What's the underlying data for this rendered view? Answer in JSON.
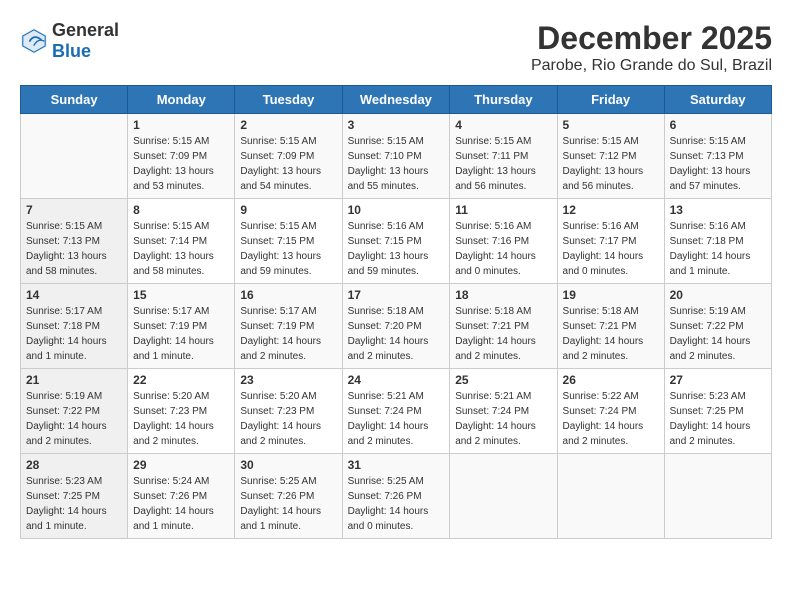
{
  "logo": {
    "general": "General",
    "blue": "Blue"
  },
  "title": "December 2025",
  "subtitle": "Parobe, Rio Grande do Sul, Brazil",
  "days_of_week": [
    "Sunday",
    "Monday",
    "Tuesday",
    "Wednesday",
    "Thursday",
    "Friday",
    "Saturday"
  ],
  "weeks": [
    [
      {
        "day": "",
        "sunrise": "",
        "sunset": "",
        "daylight": ""
      },
      {
        "day": "1",
        "sunrise": "Sunrise: 5:15 AM",
        "sunset": "Sunset: 7:09 PM",
        "daylight": "Daylight: 13 hours and 53 minutes."
      },
      {
        "day": "2",
        "sunrise": "Sunrise: 5:15 AM",
        "sunset": "Sunset: 7:09 PM",
        "daylight": "Daylight: 13 hours and 54 minutes."
      },
      {
        "day": "3",
        "sunrise": "Sunrise: 5:15 AM",
        "sunset": "Sunset: 7:10 PM",
        "daylight": "Daylight: 13 hours and 55 minutes."
      },
      {
        "day": "4",
        "sunrise": "Sunrise: 5:15 AM",
        "sunset": "Sunset: 7:11 PM",
        "daylight": "Daylight: 13 hours and 56 minutes."
      },
      {
        "day": "5",
        "sunrise": "Sunrise: 5:15 AM",
        "sunset": "Sunset: 7:12 PM",
        "daylight": "Daylight: 13 hours and 56 minutes."
      },
      {
        "day": "6",
        "sunrise": "Sunrise: 5:15 AM",
        "sunset": "Sunset: 7:13 PM",
        "daylight": "Daylight: 13 hours and 57 minutes."
      }
    ],
    [
      {
        "day": "7",
        "sunrise": "Sunrise: 5:15 AM",
        "sunset": "Sunset: 7:13 PM",
        "daylight": "Daylight: 13 hours and 58 minutes."
      },
      {
        "day": "8",
        "sunrise": "Sunrise: 5:15 AM",
        "sunset": "Sunset: 7:14 PM",
        "daylight": "Daylight: 13 hours and 58 minutes."
      },
      {
        "day": "9",
        "sunrise": "Sunrise: 5:15 AM",
        "sunset": "Sunset: 7:15 PM",
        "daylight": "Daylight: 13 hours and 59 minutes."
      },
      {
        "day": "10",
        "sunrise": "Sunrise: 5:16 AM",
        "sunset": "Sunset: 7:15 PM",
        "daylight": "Daylight: 13 hours and 59 minutes."
      },
      {
        "day": "11",
        "sunrise": "Sunrise: 5:16 AM",
        "sunset": "Sunset: 7:16 PM",
        "daylight": "Daylight: 14 hours and 0 minutes."
      },
      {
        "day": "12",
        "sunrise": "Sunrise: 5:16 AM",
        "sunset": "Sunset: 7:17 PM",
        "daylight": "Daylight: 14 hours and 0 minutes."
      },
      {
        "day": "13",
        "sunrise": "Sunrise: 5:16 AM",
        "sunset": "Sunset: 7:18 PM",
        "daylight": "Daylight: 14 hours and 1 minute."
      }
    ],
    [
      {
        "day": "14",
        "sunrise": "Sunrise: 5:17 AM",
        "sunset": "Sunset: 7:18 PM",
        "daylight": "Daylight: 14 hours and 1 minute."
      },
      {
        "day": "15",
        "sunrise": "Sunrise: 5:17 AM",
        "sunset": "Sunset: 7:19 PM",
        "daylight": "Daylight: 14 hours and 1 minute."
      },
      {
        "day": "16",
        "sunrise": "Sunrise: 5:17 AM",
        "sunset": "Sunset: 7:19 PM",
        "daylight": "Daylight: 14 hours and 2 minutes."
      },
      {
        "day": "17",
        "sunrise": "Sunrise: 5:18 AM",
        "sunset": "Sunset: 7:20 PM",
        "daylight": "Daylight: 14 hours and 2 minutes."
      },
      {
        "day": "18",
        "sunrise": "Sunrise: 5:18 AM",
        "sunset": "Sunset: 7:21 PM",
        "daylight": "Daylight: 14 hours and 2 minutes."
      },
      {
        "day": "19",
        "sunrise": "Sunrise: 5:18 AM",
        "sunset": "Sunset: 7:21 PM",
        "daylight": "Daylight: 14 hours and 2 minutes."
      },
      {
        "day": "20",
        "sunrise": "Sunrise: 5:19 AM",
        "sunset": "Sunset: 7:22 PM",
        "daylight": "Daylight: 14 hours and 2 minutes."
      }
    ],
    [
      {
        "day": "21",
        "sunrise": "Sunrise: 5:19 AM",
        "sunset": "Sunset: 7:22 PM",
        "daylight": "Daylight: 14 hours and 2 minutes."
      },
      {
        "day": "22",
        "sunrise": "Sunrise: 5:20 AM",
        "sunset": "Sunset: 7:23 PM",
        "daylight": "Daylight: 14 hours and 2 minutes."
      },
      {
        "day": "23",
        "sunrise": "Sunrise: 5:20 AM",
        "sunset": "Sunset: 7:23 PM",
        "daylight": "Daylight: 14 hours and 2 minutes."
      },
      {
        "day": "24",
        "sunrise": "Sunrise: 5:21 AM",
        "sunset": "Sunset: 7:24 PM",
        "daylight": "Daylight: 14 hours and 2 minutes."
      },
      {
        "day": "25",
        "sunrise": "Sunrise: 5:21 AM",
        "sunset": "Sunset: 7:24 PM",
        "daylight": "Daylight: 14 hours and 2 minutes."
      },
      {
        "day": "26",
        "sunrise": "Sunrise: 5:22 AM",
        "sunset": "Sunset: 7:24 PM",
        "daylight": "Daylight: 14 hours and 2 minutes."
      },
      {
        "day": "27",
        "sunrise": "Sunrise: 5:23 AM",
        "sunset": "Sunset: 7:25 PM",
        "daylight": "Daylight: 14 hours and 2 minutes."
      }
    ],
    [
      {
        "day": "28",
        "sunrise": "Sunrise: 5:23 AM",
        "sunset": "Sunset: 7:25 PM",
        "daylight": "Daylight: 14 hours and 1 minute."
      },
      {
        "day": "29",
        "sunrise": "Sunrise: 5:24 AM",
        "sunset": "Sunset: 7:26 PM",
        "daylight": "Daylight: 14 hours and 1 minute."
      },
      {
        "day": "30",
        "sunrise": "Sunrise: 5:25 AM",
        "sunset": "Sunset: 7:26 PM",
        "daylight": "Daylight: 14 hours and 1 minute."
      },
      {
        "day": "31",
        "sunrise": "Sunrise: 5:25 AM",
        "sunset": "Sunset: 7:26 PM",
        "daylight": "Daylight: 14 hours and 0 minutes."
      },
      {
        "day": "",
        "sunrise": "",
        "sunset": "",
        "daylight": ""
      },
      {
        "day": "",
        "sunrise": "",
        "sunset": "",
        "daylight": ""
      },
      {
        "day": "",
        "sunrise": "",
        "sunset": "",
        "daylight": ""
      }
    ]
  ]
}
